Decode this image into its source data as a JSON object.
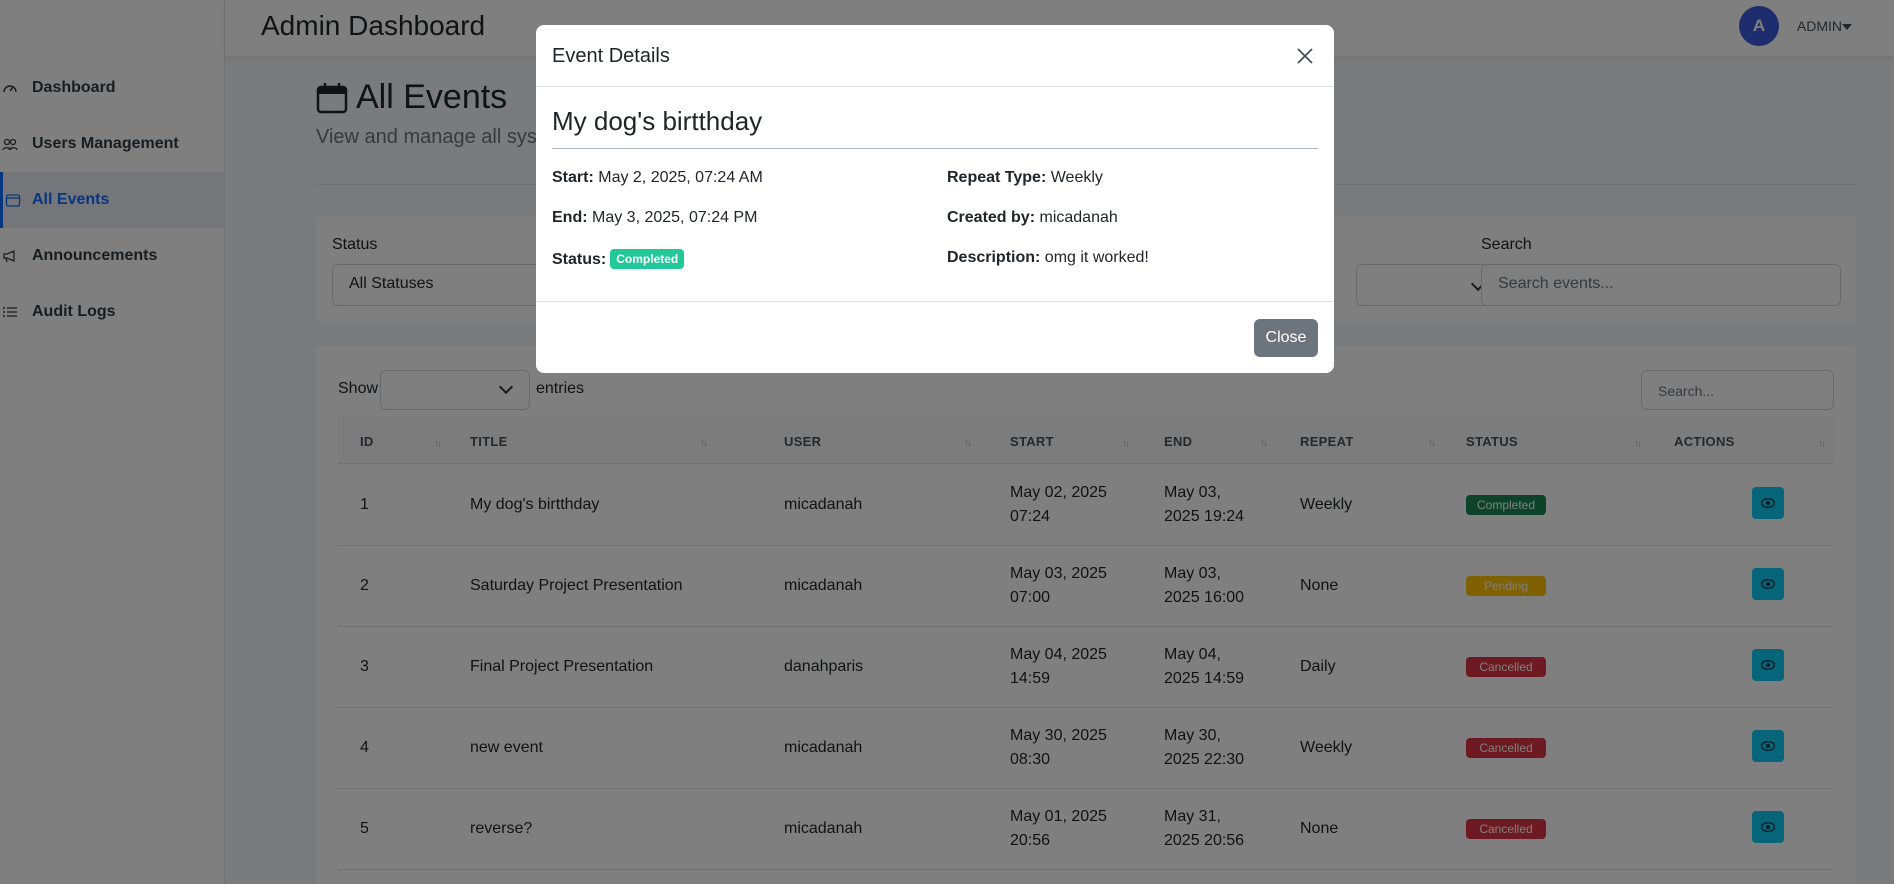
{
  "app": {
    "title": "Admin Dashboard"
  },
  "user": {
    "initial": "A",
    "name": "ADMIN"
  },
  "sidebar": {
    "items": [
      {
        "label": "Dashboard",
        "icon": "gauge-icon"
      },
      {
        "label": "Users Management",
        "icon": "users-icon"
      },
      {
        "label": "All Events",
        "icon": "calendar-icon",
        "active": true
      },
      {
        "label": "Announcements",
        "icon": "megaphone-icon"
      },
      {
        "label": "Audit Logs",
        "icon": "list-icon"
      }
    ]
  },
  "page": {
    "title": "All Events",
    "subtitle": "View and manage all syste"
  },
  "filters": {
    "status_label": "Status",
    "status_value": "All Statuses",
    "search_label": "Search",
    "search_placeholder": "Search events..."
  },
  "table": {
    "show_label": "Show",
    "entries_label": "entries",
    "search_placeholder": "Search...",
    "columns": [
      "ID",
      "TITLE",
      "USER",
      "START",
      "END",
      "REPEAT",
      "STATUS",
      "ACTIONS"
    ],
    "rows": [
      {
        "id": "1",
        "title": "My dog's birtthday",
        "user": "micadanah",
        "start": [
          "May 02, 2025",
          "07:24"
        ],
        "end": [
          "May 03,",
          "2025 19:24"
        ],
        "repeat": "Weekly",
        "status": "Completed",
        "status_color": "#198754"
      },
      {
        "id": "2",
        "title": "Saturday Project Presentation",
        "user": "micadanah",
        "start": [
          "May 03, 2025",
          "07:00"
        ],
        "end": [
          "May 03,",
          "2025 16:00"
        ],
        "repeat": "None",
        "status": "Pending",
        "status_color": "#ffc107"
      },
      {
        "id": "3",
        "title": "Final Project Presentation",
        "user": "danahparis",
        "start": [
          "May 04, 2025",
          "14:59"
        ],
        "end": [
          "May 04,",
          "2025 14:59"
        ],
        "repeat": "Daily",
        "status": "Cancelled",
        "status_color": "#dc3545"
      },
      {
        "id": "4",
        "title": "new event",
        "user": "micadanah",
        "start": [
          "May 30, 2025",
          "08:30"
        ],
        "end": [
          "May 30,",
          "2025 22:30"
        ],
        "repeat": "Weekly",
        "status": "Cancelled",
        "status_color": "#dc3545"
      },
      {
        "id": "5",
        "title": "reverse?",
        "user": "micadanah",
        "start": [
          "May 01, 2025",
          "20:56"
        ],
        "end": [
          "May 31,",
          "2025 20:56"
        ],
        "repeat": "None",
        "status": "Cancelled",
        "status_color": "#dc3545"
      }
    ]
  },
  "modal": {
    "title": "Event Details",
    "event_title": "My dog's birtthday",
    "start_label": "Start:",
    "start_value": "May 2, 2025, 07:24 AM",
    "end_label": "End:",
    "end_value": "May 3, 2025, 07:24 PM",
    "status_label": "Status:",
    "status_value": "Completed",
    "repeat_label": "Repeat Type:",
    "repeat_value": "Weekly",
    "created_label": "Created by:",
    "created_value": "micadanah",
    "desc_label": "Description:",
    "desc_value": "omg it worked!",
    "close_label": "Close"
  }
}
